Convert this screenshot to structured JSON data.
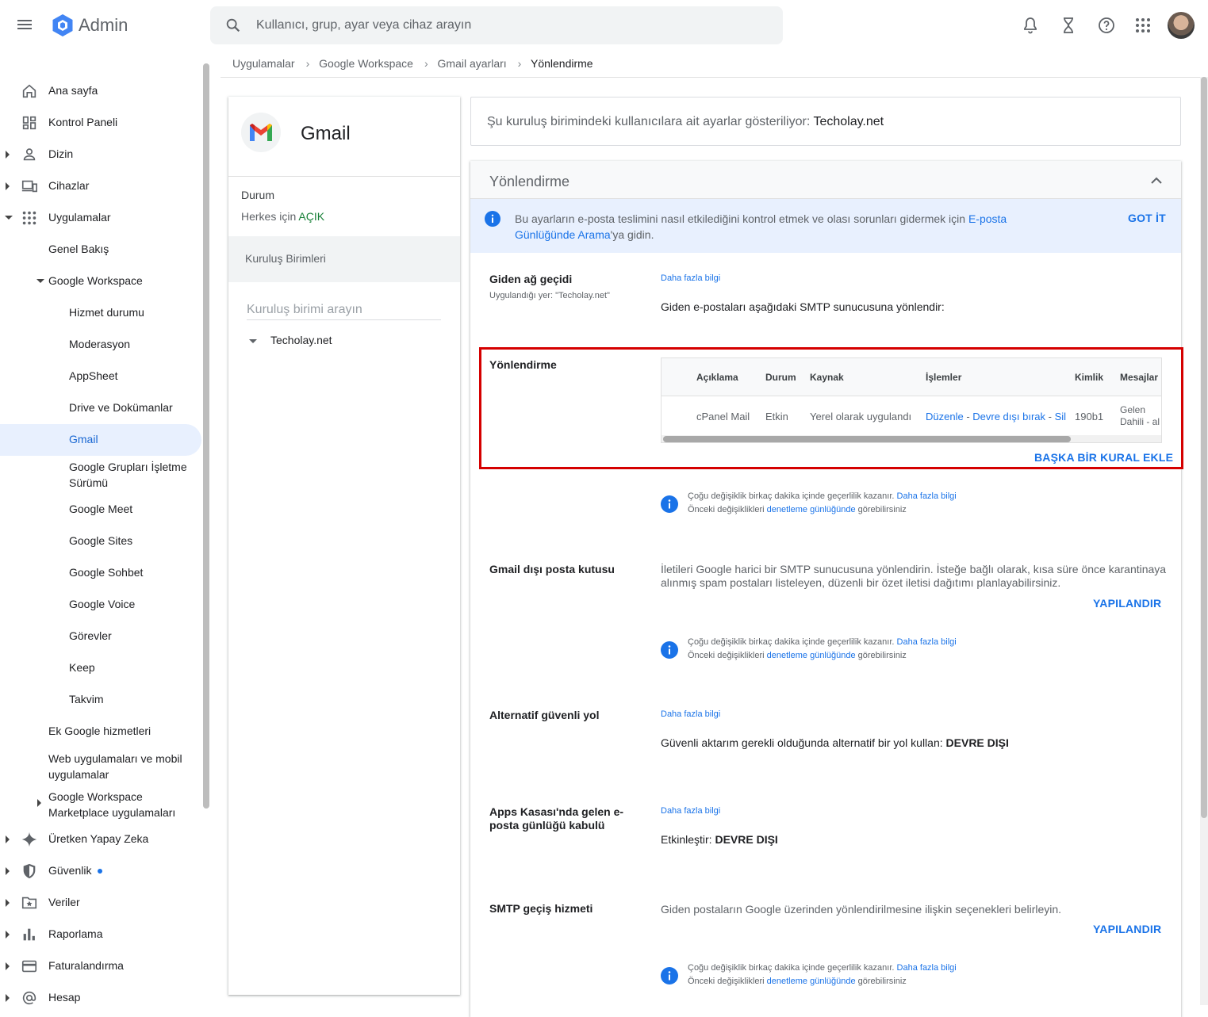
{
  "app": {
    "title": "Admin"
  },
  "search": {
    "placeholder": "Kullanıcı, grup, ayar veya cihaz arayın"
  },
  "topbar_icons": [
    "bell-icon",
    "hourglass-icon",
    "help-icon",
    "apps-grid-icon"
  ],
  "sidebar": {
    "items": [
      {
        "label": "Ana sayfa",
        "icon": "home-icon"
      },
      {
        "label": "Kontrol Paneli",
        "icon": "dashboard-icon"
      },
      {
        "label": "Dizin",
        "icon": "person-icon"
      },
      {
        "label": "Cihazlar",
        "icon": "devices-icon"
      },
      {
        "label": "Uygulamalar",
        "icon": "apps-icon"
      },
      {
        "label": "Genel Bakış"
      },
      {
        "label": "Google Workspace"
      },
      {
        "label": "Hizmet durumu"
      },
      {
        "label": "Moderasyon"
      },
      {
        "label": "AppSheet"
      },
      {
        "label": "Drive ve Dokümanlar"
      },
      {
        "label": "Gmail"
      },
      {
        "label": "Google Grupları İşletme Sürümü"
      },
      {
        "label": "Google Meet"
      },
      {
        "label": "Google Sites"
      },
      {
        "label": "Google Sohbet"
      },
      {
        "label": "Google Voice"
      },
      {
        "label": "Görevler"
      },
      {
        "label": "Keep"
      },
      {
        "label": "Takvim"
      },
      {
        "label": "Ek Google hizmetleri"
      },
      {
        "label": "Web uygulamaları ve mobil uygulamalar"
      },
      {
        "label": "Google Workspace Marketplace uygulamaları"
      },
      {
        "label": "Üretken Yapay Zeka",
        "icon": "sparkle-icon"
      },
      {
        "label": "Güvenlik",
        "icon": "shield-icon"
      },
      {
        "label": "Veriler",
        "icon": "folder-star-icon"
      },
      {
        "label": "Raporlama",
        "icon": "bar-chart-icon"
      },
      {
        "label": "Faturalandırma",
        "icon": "credit-card-icon"
      },
      {
        "label": "Hesap",
        "icon": "at-icon"
      }
    ]
  },
  "breadcrumb": [
    "Uygulamalar",
    "Google Workspace",
    "Gmail ayarları",
    "Yönlendirme"
  ],
  "app_card": {
    "title": "Gmail",
    "status_label": "Durum",
    "status_prefix": "Herkes için",
    "status_value": "AÇIK",
    "ou_header": "Kuruluş Birimleri",
    "ou_search_placeholder": "Kuruluş birimi arayın",
    "ou_root": "Techolay.net"
  },
  "org_bar": {
    "text": "Şu kuruluş birimindeki kullanıcılara ait ayarlar gösteriliyor:",
    "org": "Techolay.net"
  },
  "panel": {
    "title": "Yönlendirme",
    "info": {
      "text_before": "Bu ayarların e-posta teslimini nasıl etkilediğini kontrol etmek ve olası sorunları gidermek için",
      "link": "E-posta Günlüğünde Arama",
      "text_after": "'ya gidin.",
      "button": "GOT İT"
    },
    "outbound_gateway": {
      "title": "Giden ağ geçidi",
      "sub": "Uygulandığı yer: \"Techolay.net\"",
      "link": "Daha fazla bilgi",
      "value": "Giden e-postaları aşağıdaki SMTP sunucusuna yönlendir:"
    },
    "routing": {
      "title": "Yönlendirme",
      "columns": [
        "Açıklama",
        "Durum",
        "Kaynak",
        "İşlemler",
        "Kimlik",
        "Mesajlar"
      ],
      "row": {
        "description": "cPanel Mail",
        "status": "Etkin",
        "source": "Yerel olarak uygulandı",
        "edit": "Düzenle",
        "disable": "Devre dışı bırak",
        "delete": "Sil",
        "id": "190b1",
        "messages_1": "Gelen",
        "messages_2": "Dahili - al"
      },
      "add_button": "BAŞKA BİR KURAL EKLE"
    },
    "note": {
      "line1": "Çoğu değişiklik birkaç dakika içinde geçerlilik kazanır.",
      "line1_link": "Daha fazla bilgi",
      "line2_before": "Önceki değişiklikleri",
      "line2_link": "denetleme günlüğünde",
      "line2_after": "görebilirsiniz"
    },
    "non_gmail": {
      "title": "Gmail dışı posta kutusu",
      "desc": "İletileri Google harici bir SMTP sunucusuna yönlendirin. İsteğe bağlı olarak, kısa süre önce karantinaya alınmış spam postaları listeleyen, düzenli bir özet iletisi dağıtımı planlayabilirsiniz.",
      "button": "YAPILANDIR"
    },
    "alt_route": {
      "title": "Alternatif güvenli yol",
      "link": "Daha fazla bilgi",
      "value": "Güvenli aktarım gerekli olduğunda alternatif bir yol kullan:",
      "value_bold": "DEVRE DIŞI"
    },
    "vault": {
      "title": "Apps Kasası'nda gelen e-posta günlüğü kabulü",
      "link": "Daha fazla bilgi",
      "value": "Etkinleştir:",
      "value_bold": "DEVRE DIŞI"
    },
    "smtp_relay": {
      "title": "SMTP geçiş hizmeti",
      "desc": "Giden postaların Google üzerinden yönlendirilmesine ilişkin seçenekleri belirleyin.",
      "button": "YAPILANDIR"
    }
  },
  "colors": {
    "accent": "#1a73e8",
    "active_bg": "#e8f0fe",
    "on_green": "#188038",
    "highlight_red": "#d50000"
  }
}
